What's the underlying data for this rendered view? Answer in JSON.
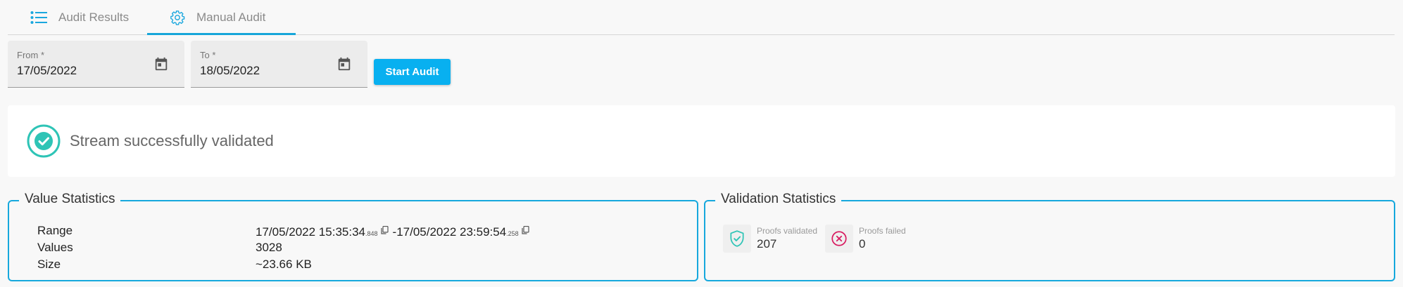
{
  "tabs": {
    "results": {
      "label": "Audit Results",
      "icon": "list-icon"
    },
    "manual": {
      "label": "Manual Audit",
      "icon": "gear-icon",
      "active": true
    }
  },
  "form": {
    "from": {
      "label": "From *",
      "value": "17/05/2022"
    },
    "to": {
      "label": "To *",
      "value": "18/05/2022"
    },
    "start_button": "Start Audit"
  },
  "status": {
    "message": "Stream successfully validated",
    "icon": "check-circle-icon"
  },
  "value_statistics": {
    "title": "Value Statistics",
    "range_label": "Range",
    "range_start": "17/05/2022 15:35:34",
    "range_start_ms": ".848",
    "range_sep": "-",
    "range_end": "17/05/2022 23:59:54",
    "range_end_ms": ".258",
    "values_label": "Values",
    "values_value": "3028",
    "size_label": "Size",
    "size_value": "~23.66 KB"
  },
  "validation_statistics": {
    "title": "Validation Statistics",
    "validated_label": "Proofs validated",
    "validated_value": "207",
    "failed_label": "Proofs failed",
    "failed_value": "0"
  },
  "colors": {
    "accent": "#16a8dd",
    "button": "#08b0f0",
    "success": "#2ec4b6",
    "danger": "#d81b60"
  }
}
